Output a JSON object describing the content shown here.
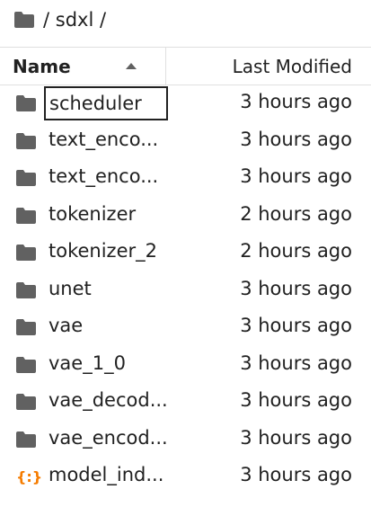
{
  "breadcrumb": {
    "path": "/ sdxl /"
  },
  "header": {
    "name_label": "Name",
    "modified_label": "Last Modified"
  },
  "files": [
    {
      "name": "scheduler",
      "modified": "3 hours ago",
      "icon": "folder-icon",
      "selected": true
    },
    {
      "name": "text_enco...",
      "modified": "3 hours ago",
      "icon": "folder-icon"
    },
    {
      "name": "text_enco...",
      "modified": "3 hours ago",
      "icon": "folder-icon"
    },
    {
      "name": "tokenizer",
      "modified": "2 hours ago",
      "icon": "folder-icon"
    },
    {
      "name": "tokenizer_2",
      "modified": "2 hours ago",
      "icon": "folder-icon"
    },
    {
      "name": "unet",
      "modified": "3 hours ago",
      "icon": "folder-icon"
    },
    {
      "name": "vae",
      "modified": "3 hours ago",
      "icon": "folder-icon"
    },
    {
      "name": "vae_1_0",
      "modified": "3 hours ago",
      "icon": "folder-icon"
    },
    {
      "name": "vae_decod...",
      "modified": "3 hours ago",
      "icon": "folder-icon"
    },
    {
      "name": "vae_encod...",
      "modified": "3 hours ago",
      "icon": "folder-icon"
    },
    {
      "name": "model_ind...",
      "modified": "3 hours ago",
      "icon": "json-icon"
    }
  ],
  "colors": {
    "folder": "#616161",
    "json": "#f57c00",
    "border": "#e0e0e0"
  }
}
